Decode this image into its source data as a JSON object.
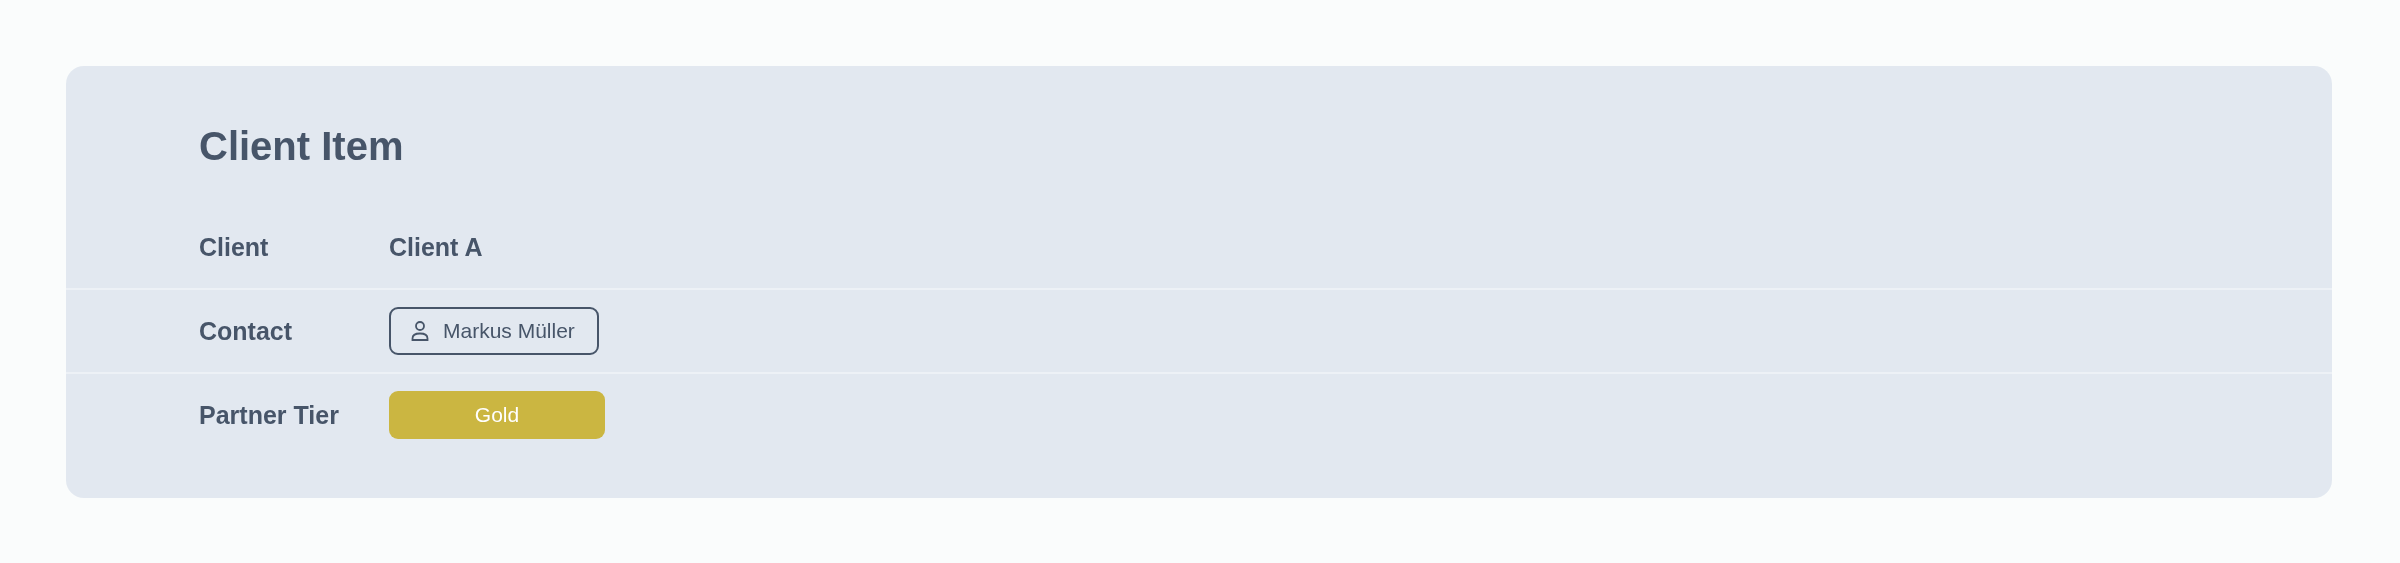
{
  "card": {
    "title": "Client Item",
    "rows": [
      {
        "label": "Client",
        "kind": "text",
        "value": "Client A"
      },
      {
        "label": "Contact",
        "kind": "contact",
        "value": "Markus Müller"
      },
      {
        "label": "Partner Tier",
        "kind": "tier",
        "value": "Gold",
        "color": "#cbb641"
      }
    ]
  }
}
